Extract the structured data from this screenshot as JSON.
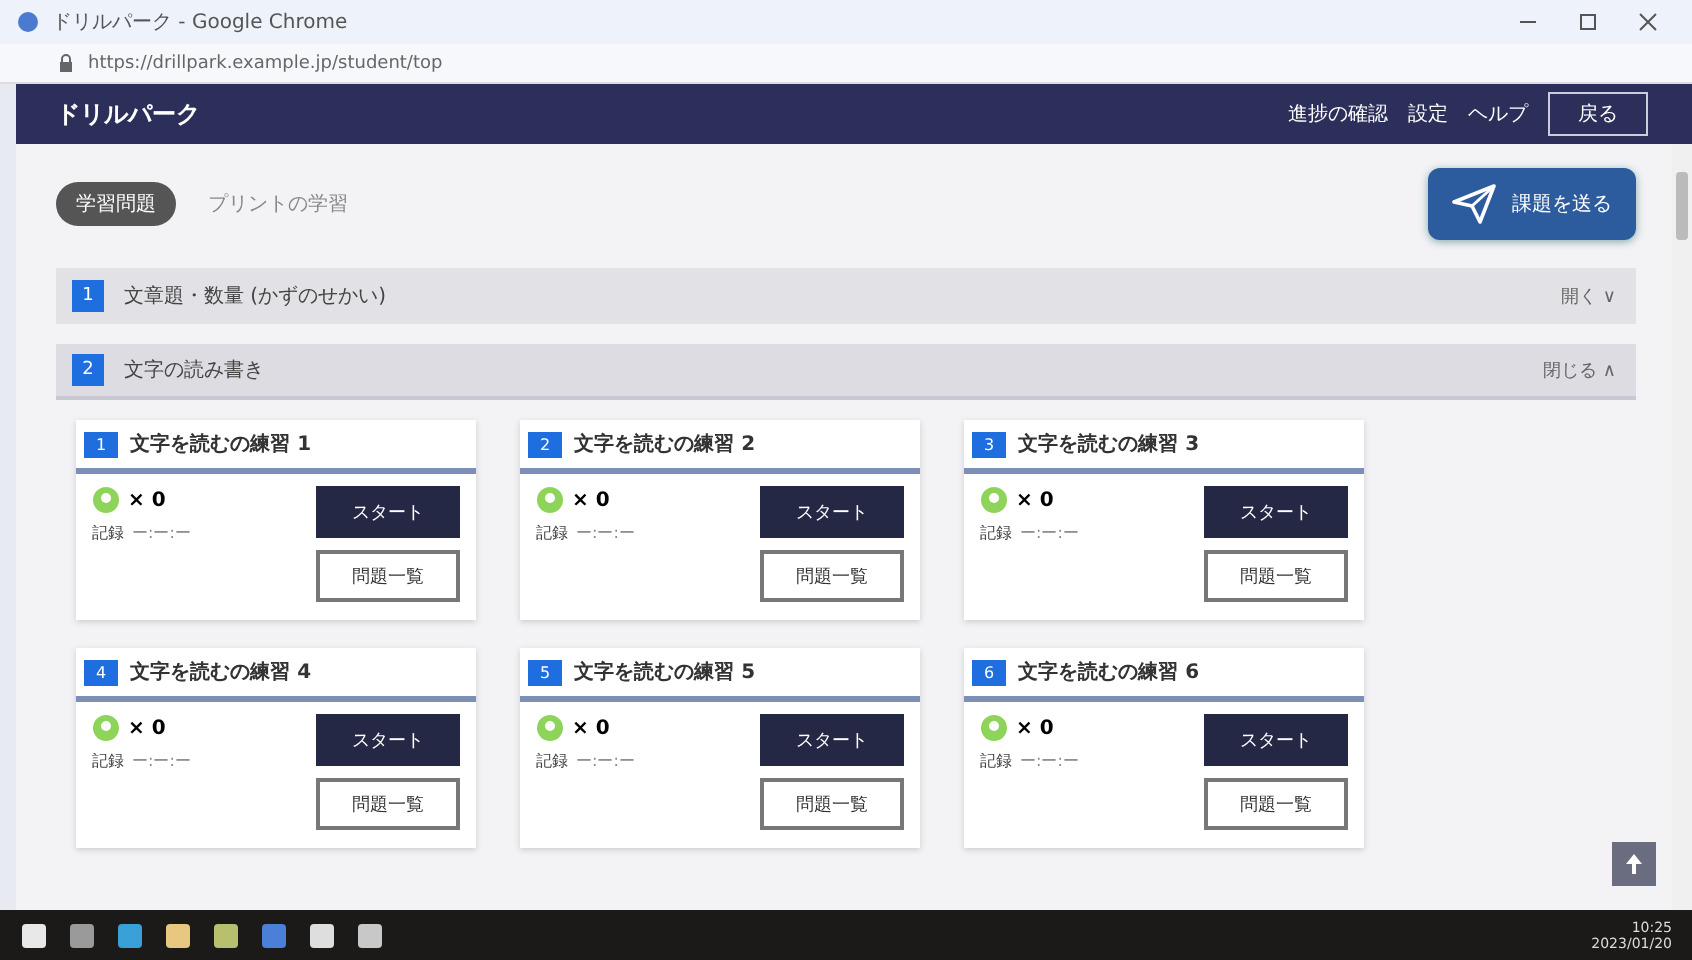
{
  "browser": {
    "title": "ドリルパーク - Google Chrome",
    "url": "https://drillpark.example.jp/student/top"
  },
  "header": {
    "title": "ドリルパーク",
    "links": [
      "進捗の確認",
      "設定",
      "ヘルプ"
    ],
    "button": "戻る"
  },
  "tabs": [
    {
      "label": "学習問題",
      "selected": true
    },
    {
      "label": "プリントの学習",
      "selected": false
    }
  ],
  "send_button": "課題を送る",
  "sections": [
    {
      "number": "1",
      "title": "文章題・数量 (かずのせかい)",
      "toggle": "開く ∨",
      "expanded": false
    },
    {
      "number": "2",
      "title": "文字の読み書き",
      "toggle": "閉じる ∧",
      "expanded": true,
      "cards": [
        {
          "tag": "1",
          "title": "文字を読むの練習 1",
          "count": "× 0",
          "record_label": "記録",
          "record": "ー:ー:ー",
          "start": "スタート",
          "list": "問題一覧"
        },
        {
          "tag": "2",
          "title": "文字を読むの練習 2",
          "count": "× 0",
          "record_label": "記録",
          "record": "ー:ー:ー",
          "start": "スタート",
          "list": "問題一覧"
        },
        {
          "tag": "3",
          "title": "文字を読むの練習 3",
          "count": "× 0",
          "record_label": "記録",
          "record": "ー:ー:ー",
          "start": "スタート",
          "list": "問題一覧"
        },
        {
          "tag": "4",
          "title": "文字を読むの練習 4",
          "count": "× 0",
          "record_label": "記録",
          "record": "ー:ー:ー",
          "start": "スタート",
          "list": "問題一覧"
        },
        {
          "tag": "5",
          "title": "文字を読むの練習 5",
          "count": "× 0",
          "record_label": "記録",
          "record": "ー:ー:ー",
          "start": "スタート",
          "list": "問題一覧"
        },
        {
          "tag": "6",
          "title": "文字を読むの練習 6",
          "count": "× 0",
          "record_label": "記録",
          "record": "ー:ー:ー",
          "start": "スタート",
          "list": "問題一覧"
        }
      ]
    }
  ],
  "taskbar": {
    "time": "10:25",
    "date": "2023/01/20"
  }
}
